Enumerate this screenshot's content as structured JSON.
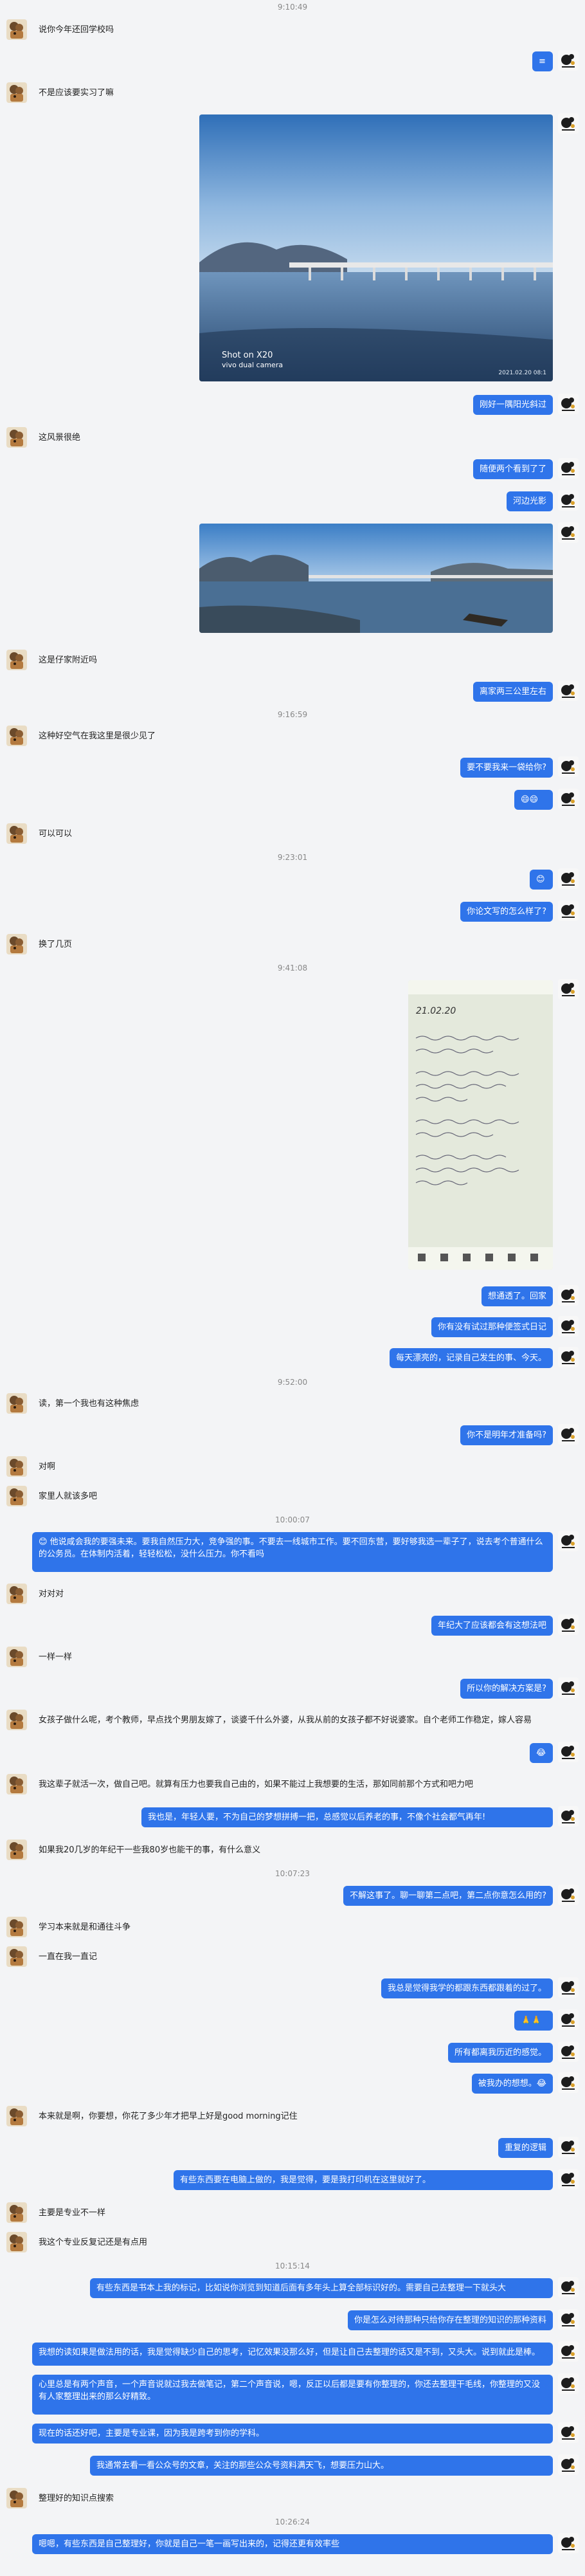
{
  "timestamps": [
    "9:10:49",
    "9:16:59",
    "9:23:01",
    "9:41:08",
    "9:52:00",
    "10:00:07",
    "10:07:23",
    "10:15:14",
    "10:26:24"
  ],
  "messages": [
    "说你今年还回学校吗",
    "≡",
    "不是应该要实习了嘛",
    "Shot on X20",
    "vivo dual camera",
    "2021.02.20 08:1",
    "刚好一隅阳光斜过",
    "这风景很绝",
    "随便两个看到了了",
    "河边光影",
    "这是仔家附近吗",
    "离家两三公里左右",
    "这种好空气在我这里是很少见了",
    "要不要我来一袋给你?",
    "😄😄",
    "可以可以",
    "😊",
    "你论文写的怎么样了?",
    "换了几页",
    "21.02.20",
    "想通透了。回家",
    "你有没有试过那种便签式日记",
    "每天漂亮的，记录自己发生的事、今天。",
    "读，第一个我也有这种焦虑",
    "你不是明年才准备吗?",
    "对啊",
    "家里人就该多吧",
    "😊 他说咸会我的要强未来。要我自然压力大，竞争强的事。不要去一线城市工作。要不回东营，要好够我选一辈子了，说去考个普通什么的公务员。在体制内活着，轻轻松松，没什么压力。你不看吗",
    "对对对",
    "年纪大了应该都会有这想法吧",
    "一样一样",
    "所以你的解决方案是?",
    "女孩子做什么呢，考个教师，早点找个男朋友嫁了，谈婆千什么外婆，从我从前的女孩子都不好说婆家。自个老师工作稳定，嫁人容易",
    "😂",
    "我这辈子就活一次，做自己吧。就算有压力也要我自己由的，如果不能过上我想要的生活，那如同前那个方式和吧力吧",
    "我也是，年轻人要，不为自己的梦想拼搏一把，总感觉以后养老的事，不像个社会都气再年!",
    "如果我20几岁的年纪干一些我80岁也能干的事，有什么意义",
    "不解这事了。聊一聊第二点吧，第二点你意怎么用的?",
    "学习本来就是和通往斗争",
    "一直在我一直记",
    "我总是觉得我学的都跟东西都跟着的过了。",
    "🙏🙏",
    "所有都离我历近的感觉。",
    "被我办的想想。😂",
    "本来就是啊，你要想，你花了多少年才把早上好是good morning记住",
    "重复的逻辑",
    "有些东西要在电脑上做的，我是觉得，要是我打印机在这里就好了。",
    "主要是专业不一样",
    "我这个专业反复记还是有点用",
    "有些东西是书本上我的标记，比如说你浏览到知道后面有多年头上算全部标识好的。需要自己去整理一下就头大",
    "你是怎么对待那种只给你存在整理的知识的那种资料",
    "我想的读如果是做法用的话，我是觉得缺少自己的思考，记忆效果没那么好，但是让自己去整理的话又是不到，又头大。说到就此是棒。",
    "心里总是有两个声音，一个声音说就过我去做笔记，第二个声音说，嗯，反正以后都是要有你整理的，你还去整理干毛线，你整理的又没有人家整理出来的那么好精致。",
    "现在的话还好吧，主要是专业课，因为我是跨考到你的学科。",
    "我通常去看一看公众号的文章，关注的那些公众号资料满天飞，想要压力山大。",
    "整理好的知识点搜索",
    "嗯嗯，有些东西是自己整理好，你就是自己一笔一画写出来的，记得还更有效率些"
  ]
}
